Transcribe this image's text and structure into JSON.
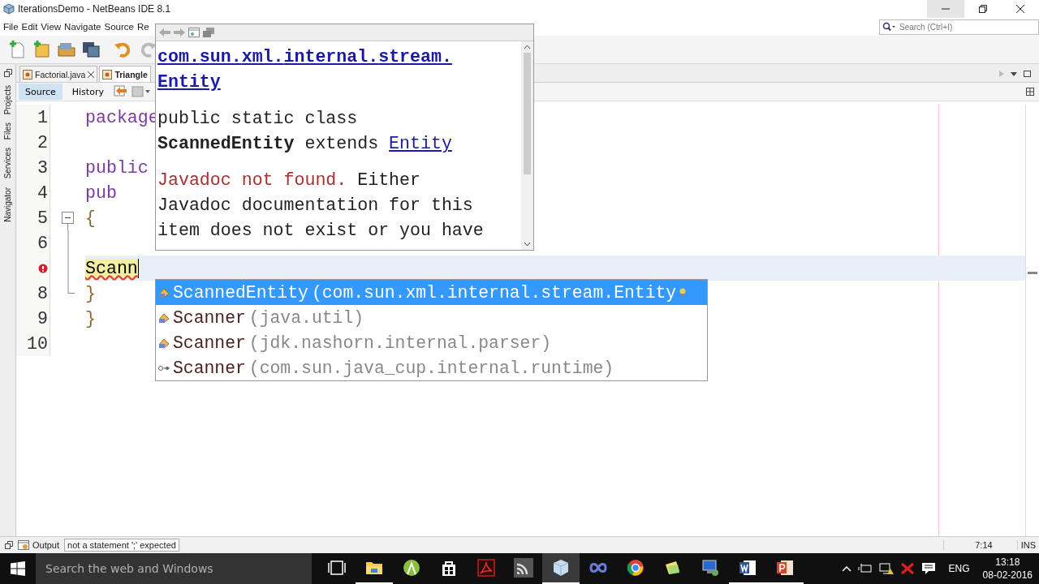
{
  "window": {
    "title": "IterationsDemo - NetBeans IDE 8.1"
  },
  "menu": [
    "File",
    "Edit",
    "View",
    "Navigate",
    "Source",
    "Re"
  ],
  "search": {
    "placeholder": "Search (Ctrl+I)"
  },
  "sidebar": {
    "items": [
      "Projects",
      "Files",
      "Services",
      "Navigator"
    ]
  },
  "tabs": [
    {
      "label": "Factorial.java",
      "selected": false,
      "closable": true
    },
    {
      "label": "Triangle",
      "selected": true,
      "closable": false
    }
  ],
  "editor_toolbar": {
    "views": [
      {
        "label": "Source",
        "selected": true
      },
      {
        "label": "History",
        "selected": false
      }
    ]
  },
  "code": [
    {
      "number": "1",
      "text": "package",
      "kind": "keyword"
    },
    {
      "number": "2"
    },
    {
      "number": "3",
      "text": "public",
      "kind": "keyword"
    },
    {
      "number": "4",
      "text": "    pub",
      "kind": "keyword"
    },
    {
      "number": "5",
      "text": "    {",
      "kind": "brace",
      "expanded": true
    },
    {
      "number": "6"
    },
    {
      "text": "        Scann",
      "kind": "unresolved",
      "error": true,
      "current": true
    },
    {
      "number": "8",
      "text": "    }",
      "kind": "brace",
      "fold_end": true
    },
    {
      "number": "9",
      "text": "}",
      "kind": "brace"
    },
    {
      "number": "10"
    }
  ],
  "javadoc": {
    "header_link": "com.sun.xml.internal.stream.Entity",
    "signature": "public static class",
    "declaration": "**ScannedEntity** extends",
    "signature_link": "Entity",
    "status": "Javadoc not found.",
    "message": "Either Javadoc documentation for this item does not exist or you have"
  },
  "completion": [
    {
      "name": "ScannedEntity",
      "detail": "(com.sun.xml.internal.stream.Entity",
      "kind": "class",
      "selected": true,
      "hint": true
    },
    {
      "name": "Scanner",
      "detail": "(java.util)",
      "kind": "class",
      "selected": false,
      "hint": false
    },
    {
      "name": "Scanner",
      "detail": "(jdk.nashorn.internal.parser)",
      "kind": "class",
      "selected": false,
      "hint": false
    },
    {
      "name": "Scanner",
      "detail": "(com.sun.java_cup.internal.runtime)",
      "kind": "reference",
      "selected": false,
      "hint": false
    }
  ],
  "status_bar": {
    "output_tab": "Output",
    "message": "not a statement ';' expected",
    "position": "7:14",
    "mode": "INS"
  },
  "taskbar": {
    "search_placeholder": "Search the web and Windows",
    "apps": [
      {
        "kind": "task-view",
        "selected": false,
        "running": false
      },
      {
        "kind": "folder",
        "selected": false,
        "running": true
      },
      {
        "kind": "robot",
        "selected": false,
        "running": false
      },
      {
        "kind": "bag",
        "selected": false,
        "running": false
      },
      {
        "kind": "pdf",
        "selected": false,
        "running": false
      },
      {
        "kind": "feed",
        "selected": false,
        "running": false
      },
      {
        "kind": "cube",
        "selected": true,
        "running": true
      },
      {
        "kind": "infinity",
        "selected": false,
        "running": false
      },
      {
        "kind": "browser",
        "selected": false,
        "running": false
      },
      {
        "kind": "notes",
        "selected": false,
        "running": false
      },
      {
        "kind": "monitor",
        "selected": false,
        "running": false
      },
      {
        "kind": "word",
        "selected": false,
        "running": true
      },
      {
        "kind": "slides",
        "selected": false,
        "running": true
      }
    ],
    "language": "ENG",
    "time": "13:18",
    "date": "08-02-2016"
  }
}
